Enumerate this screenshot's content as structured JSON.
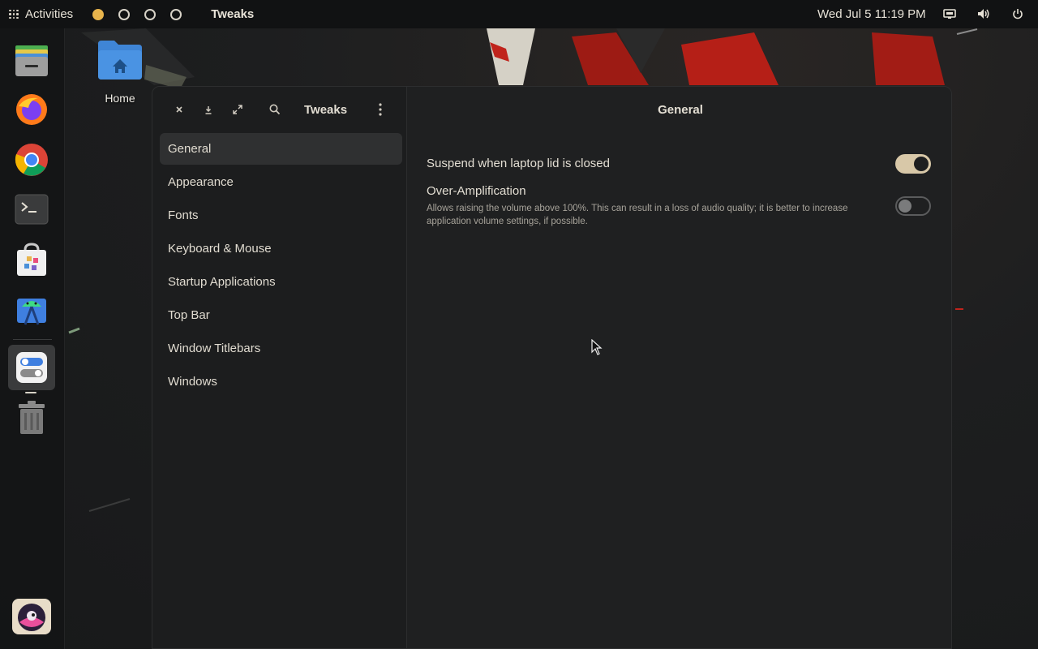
{
  "topbar": {
    "activities_label": "Activities",
    "app_name": "Tweaks",
    "clock": "Wed Jul 5  11:19 PM",
    "workspaces": [
      "active",
      "inactive",
      "inactive",
      "inactive"
    ],
    "tray_icons": [
      "network-icon",
      "volume-icon",
      "power-icon"
    ]
  },
  "dock": {
    "apps": [
      {
        "name": "files-app-icon"
      },
      {
        "name": "firefox-icon"
      },
      {
        "name": "chrome-icon"
      },
      {
        "name": "terminal-icon"
      },
      {
        "name": "software-store-icon"
      },
      {
        "name": "android-studio-icon"
      },
      {
        "name": "tweaks-app-icon",
        "active": true
      },
      {
        "name": "trash-icon"
      },
      {
        "name": "show-apps-avatar-icon"
      }
    ]
  },
  "desktop": {
    "home_label": "Home"
  },
  "window": {
    "sidebar_title": "Tweaks",
    "content_title": "General",
    "nav": [
      "General",
      "Appearance",
      "Fonts",
      "Keyboard & Mouse",
      "Startup Applications",
      "Top Bar",
      "Window Titlebars",
      "Windows"
    ],
    "selected_nav": "General",
    "settings": {
      "suspend": {
        "label": "Suspend when laptop lid is closed",
        "enabled": true
      },
      "over_amp": {
        "label": "Over-Amplification",
        "description": "Allows raising the volume above 100%. This can result in a loss of audio quality; it is better to increase application volume settings, if possible.",
        "enabled": false
      }
    }
  },
  "colors": {
    "accent_workspace": "#e8b44c",
    "toggle_on": "#d8c8a8",
    "topbar_bg": "#111213",
    "window_bg": "#1f2021"
  }
}
